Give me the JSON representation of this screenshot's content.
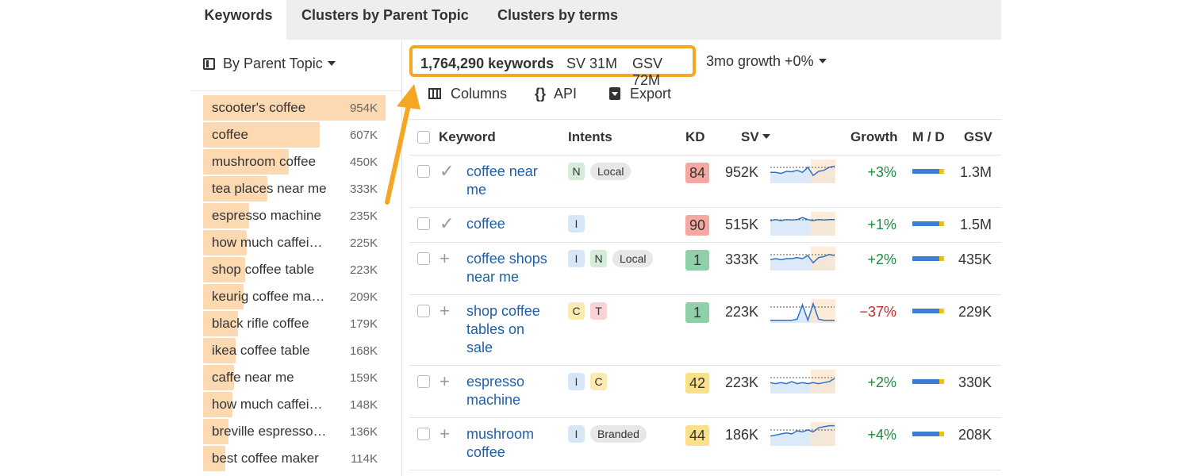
{
  "tabs": [
    "Keywords",
    "Clusters by Parent Topic",
    "Clusters by terms"
  ],
  "sidebar": {
    "group_label": "By Parent Topic",
    "items": [
      {
        "label": "scooter's coffee",
        "count": "954K",
        "share": 1.0
      },
      {
        "label": "coffee",
        "count": "607K",
        "share": 0.64
      },
      {
        "label": "mushroom coffee",
        "count": "450K",
        "share": 0.47
      },
      {
        "label": "tea places near me",
        "count": "333K",
        "share": 0.35
      },
      {
        "label": "espresso machine",
        "count": "235K",
        "share": 0.25
      },
      {
        "label": "how much caffei…",
        "count": "225K",
        "share": 0.24
      },
      {
        "label": "shop coffee table",
        "count": "223K",
        "share": 0.23
      },
      {
        "label": "keurig coffee ma…",
        "count": "209K",
        "share": 0.22
      },
      {
        "label": "black rifle coffee",
        "count": "179K",
        "share": 0.19
      },
      {
        "label": "ikea coffee table",
        "count": "168K",
        "share": 0.18
      },
      {
        "label": "caffe near me",
        "count": "159K",
        "share": 0.17
      },
      {
        "label": "how much caffei…",
        "count": "148K",
        "share": 0.16
      },
      {
        "label": "breville espresso…",
        "count": "136K",
        "share": 0.14
      },
      {
        "label": "best coffee maker",
        "count": "114K",
        "share": 0.12
      }
    ]
  },
  "summary": {
    "keywords": "1,764,290 keywords",
    "sv": "SV 31M",
    "gsv": "GSV 72M",
    "growth": "3mo growth +0%"
  },
  "toolbar": {
    "columns": "Columns",
    "api": "API",
    "export": "Export",
    "api_icon": "{}"
  },
  "table": {
    "headers": {
      "keyword": "Keyword",
      "intents": "Intents",
      "kd": "KD",
      "sv": "SV",
      "growth": "Growth",
      "md": "M / D",
      "gsv": "GSV"
    },
    "rows": [
      {
        "keyword": "coffee near me",
        "status": "check",
        "status_glyph": "✓",
        "intents": [
          {
            "t": "N",
            "k": "N"
          },
          {
            "t": "Local",
            "k": "word"
          }
        ],
        "kd": "84",
        "kd_color": "#f6a8a0",
        "sv": "952K",
        "growth": "+3%",
        "growth_color": "#1e8a3e",
        "gsv": "1.3M",
        "trend": [
          0.55,
          0.55,
          0.6,
          0.5,
          0.52,
          0.45,
          0.55,
          0.3,
          0.7,
          0.5,
          0.45,
          0.3,
          0.25
        ]
      },
      {
        "keyword": "coffee",
        "status": "check",
        "status_glyph": "✓",
        "intents": [
          {
            "t": "I",
            "k": "I"
          }
        ],
        "kd": "90",
        "kd_color": "#f6a8a0",
        "sv": "515K",
        "growth": "+1%",
        "growth_color": "#1e8a3e",
        "gsv": "1.5M",
        "trend": [
          0.35,
          0.3,
          0.35,
          0.3,
          0.32,
          0.3,
          0.2,
          0.3,
          0.35,
          0.3,
          0.32,
          0.3,
          0.3
        ]
      },
      {
        "keyword": "coffee shops near me",
        "status": "plus",
        "status_glyph": "+",
        "intents": [
          {
            "t": "I",
            "k": "I"
          },
          {
            "t": "N",
            "k": "N"
          },
          {
            "t": "Local",
            "k": "word"
          }
        ],
        "kd": "1",
        "kd_color": "#8fd0a8",
        "sv": "333K",
        "growth": "+2%",
        "growth_color": "#1e8a3e",
        "gsv": "435K",
        "trend": [
          0.55,
          0.5,
          0.55,
          0.5,
          0.5,
          0.45,
          0.5,
          0.35,
          0.7,
          0.45,
          0.4,
          0.3,
          0.35
        ]
      },
      {
        "keyword": "shop coffee tables on sale",
        "status": "plus",
        "status_glyph": "+",
        "intents": [
          {
            "t": "C",
            "k": "C"
          },
          {
            "t": "T",
            "k": "T"
          }
        ],
        "kd": "1",
        "kd_color": "#8fd0a8",
        "sv": "223K",
        "growth": "−37%",
        "growth_color": "#c62828",
        "gsv": "229K",
        "trend": [
          0.95,
          0.95,
          0.95,
          0.95,
          0.95,
          0.9,
          0.2,
          0.95,
          0.15,
          0.9,
          0.95,
          0.95,
          0.95
        ]
      },
      {
        "keyword": "espresso machine",
        "status": "plus",
        "status_glyph": "+",
        "intents": [
          {
            "t": "I",
            "k": "I"
          },
          {
            "t": "C",
            "k": "C"
          }
        ],
        "kd": "42",
        "kd_color": "#fbe08a",
        "sv": "223K",
        "growth": "+2%",
        "growth_color": "#1e8a3e",
        "gsv": "330K",
        "trend": [
          0.55,
          0.6,
          0.55,
          0.6,
          0.5,
          0.6,
          0.55,
          0.6,
          0.55,
          0.6,
          0.55,
          0.5,
          0.35
        ]
      },
      {
        "keyword": "mushroom coffee",
        "status": "plus",
        "status_glyph": "+",
        "intents": [
          {
            "t": "I",
            "k": "I"
          },
          {
            "t": "Branded",
            "k": "word"
          }
        ],
        "kd": "44",
        "kd_color": "#fbe08a",
        "sv": "186K",
        "growth": "+4%",
        "growth_color": "#1e8a3e",
        "gsv": "208K",
        "trend": [
          0.6,
          0.55,
          0.5,
          0.45,
          0.5,
          0.35,
          0.4,
          0.3,
          0.4,
          0.2,
          0.15,
          0.1,
          0.1
        ]
      }
    ]
  },
  "colors": {
    "accent": "#f5a623",
    "link": "#1f5fa8",
    "bar": "#fcd9b0"
  }
}
